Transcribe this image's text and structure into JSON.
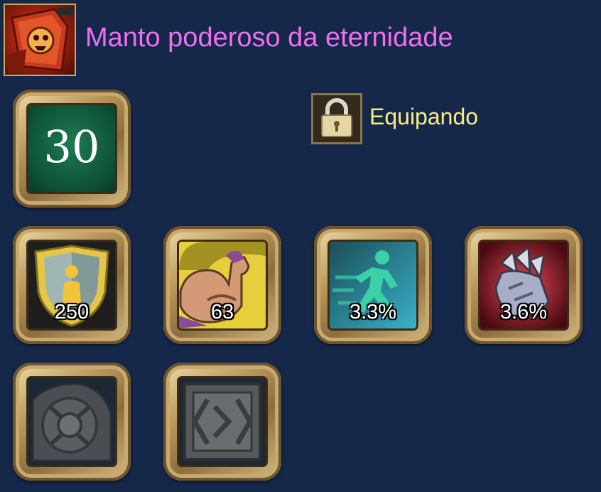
{
  "item": {
    "name": "Manto poderoso da eternidade",
    "name_color": "#f06ef0",
    "icon": "cloak-item-icon"
  },
  "level": {
    "value": "30"
  },
  "status": {
    "label": "Equipando",
    "icon": "lock-icon"
  },
  "stats": [
    {
      "icon": "shield-defense-icon",
      "value": "250"
    },
    {
      "icon": "strength-arm-icon",
      "value": "63"
    },
    {
      "icon": "running-speed-icon",
      "value": "3.3%"
    },
    {
      "icon": "claw-critical-icon",
      "value": "3.6%"
    }
  ],
  "sockets": [
    {
      "icon": "round-rune-socket-icon"
    },
    {
      "icon": "square-rune-socket-icon"
    }
  ],
  "colors": {
    "background": "#15284a",
    "status_text": "#f8ee7c",
    "frame_gold": "#c8aa6e"
  }
}
